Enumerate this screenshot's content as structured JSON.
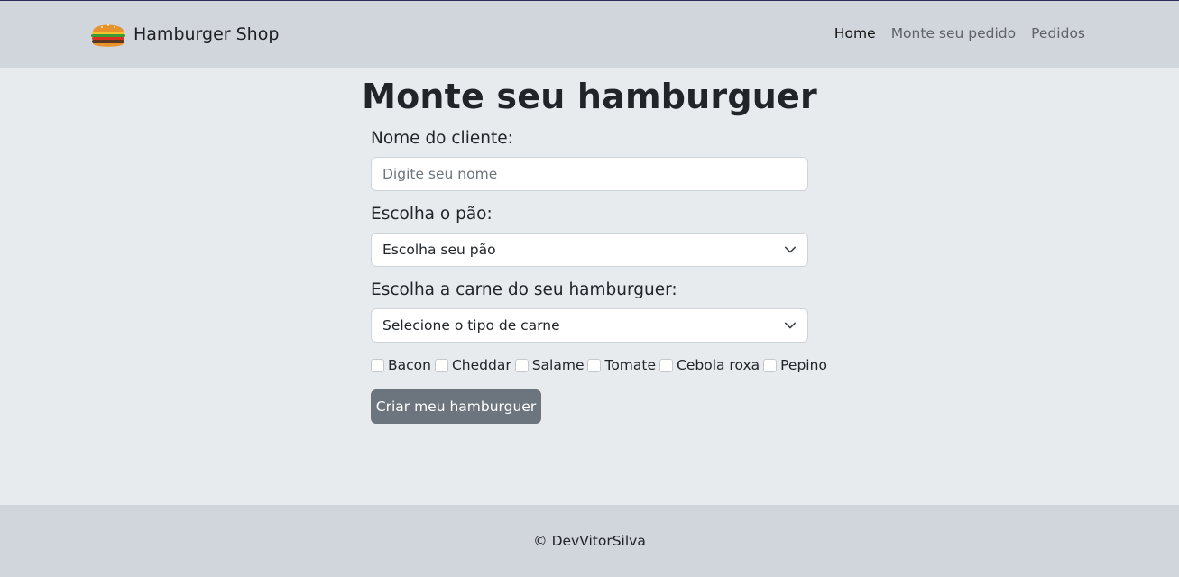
{
  "header": {
    "brand": "Hamburger Shop",
    "logo_icon": "hamburger-icon",
    "nav": [
      {
        "label": "Home",
        "active": true
      },
      {
        "label": "Monte seu pedido",
        "active": false
      },
      {
        "label": "Pedidos",
        "active": false
      }
    ]
  },
  "main": {
    "title": "Monte seu hamburguer",
    "name_field": {
      "label": "Nome do cliente:",
      "value": "",
      "placeholder": "Digite seu nome"
    },
    "bread_field": {
      "label": "Escolha o pão:",
      "selected": "Escolha seu pão"
    },
    "meat_field": {
      "label": "Escolha a carne do seu hamburguer:",
      "selected": "Selecione o tipo de carne"
    },
    "extras": [
      "Bacon",
      "Cheddar",
      "Salame",
      "Tomate",
      "Cebola roxa",
      "Pepino"
    ],
    "submit_label": "Criar meu hamburguer"
  },
  "footer": {
    "copyright": "© DevVitorSilva"
  },
  "colors": {
    "header_bg": "#d1d5dc",
    "page_bg": "#e8ebee",
    "button_bg": "#6c757d"
  }
}
